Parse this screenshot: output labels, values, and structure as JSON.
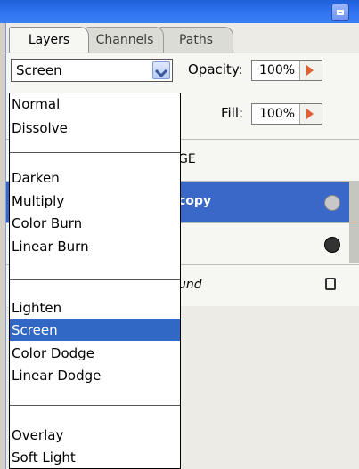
{
  "tabs": {
    "layers": "Layers",
    "channels": "Channels",
    "paths": "Paths"
  },
  "blend_mode": {
    "selected": "Screen"
  },
  "opacity": {
    "label": "Opacity:",
    "value": "100%"
  },
  "fill": {
    "label": "Fill:",
    "value": "100%"
  },
  "layers_rows": {
    "row1": "GE",
    "row2": "copy",
    "row4": "und"
  },
  "menu": {
    "items": [
      "Normal",
      "Dissolve",
      "Darken",
      "Multiply",
      "Color Burn",
      "Linear Burn",
      "Lighten",
      "Screen",
      "Color Dodge",
      "Linear Dodge",
      "Overlay",
      "Soft Light"
    ],
    "selected": "Screen"
  }
}
